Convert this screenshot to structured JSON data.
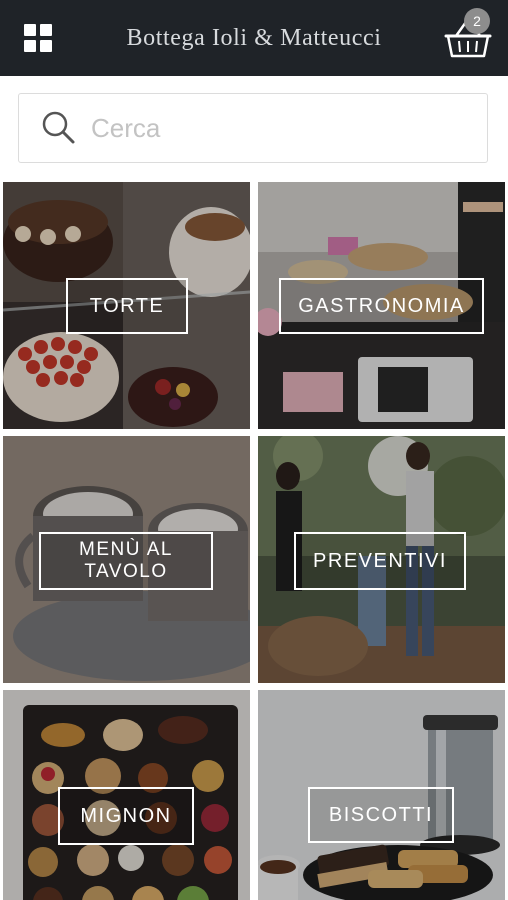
{
  "header": {
    "title": "Bottega Ioli & Matteucci",
    "cart_count": "2"
  },
  "search": {
    "placeholder": "Cerca"
  },
  "categories": [
    {
      "label": "TORTE"
    },
    {
      "label": "GASTRONOMIA"
    },
    {
      "label": "MENÙ AL\nTAVOLO"
    },
    {
      "label": "PREVENTIVI"
    },
    {
      "label": "MIGNON"
    },
    {
      "label": "BISCOTTI"
    }
  ],
  "colors": {
    "topbar": "#1f2328",
    "badge": "#8d8d8d"
  },
  "icons": {
    "menu": "grid-menu-icon",
    "cart": "shopping-basket-icon",
    "search": "search-icon"
  }
}
